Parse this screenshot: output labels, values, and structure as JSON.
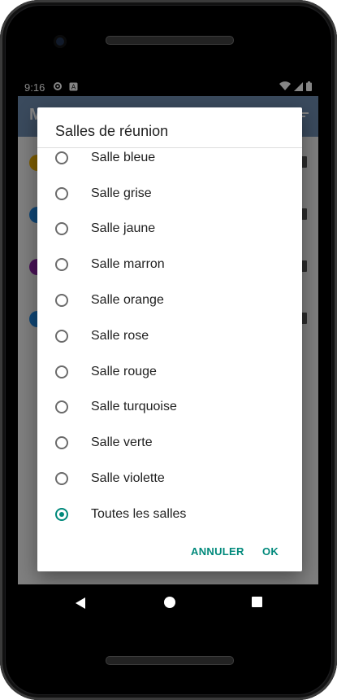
{
  "status_bar": {
    "time": "9:16",
    "icons": [
      "settings-icon",
      "a-icon",
      "wifi-icon",
      "signal-icon",
      "battery-icon"
    ]
  },
  "app_bar": {
    "title_visible": "M",
    "menu_icon": "sort-icon"
  },
  "background_rows": [
    {
      "dot_color": "#f4b400"
    },
    {
      "dot_color": "#1e88e5"
    },
    {
      "dot_color": "#8e24aa"
    },
    {
      "dot_color": "#1e88e5"
    }
  ],
  "dialog": {
    "title": "Salles de réunion",
    "options": [
      {
        "label": "Salle bleue",
        "checked": false
      },
      {
        "label": "Salle grise",
        "checked": false
      },
      {
        "label": "Salle jaune",
        "checked": false
      },
      {
        "label": "Salle marron",
        "checked": false
      },
      {
        "label": "Salle orange",
        "checked": false
      },
      {
        "label": "Salle rose",
        "checked": false
      },
      {
        "label": "Salle rouge",
        "checked": false
      },
      {
        "label": "Salle turquoise",
        "checked": false
      },
      {
        "label": "Salle verte",
        "checked": false
      },
      {
        "label": "Salle violette",
        "checked": false
      },
      {
        "label": "Toutes les salles",
        "checked": true
      }
    ],
    "cancel_label": "ANNULER",
    "ok_label": "OK"
  },
  "colors": {
    "accent": "#00897b",
    "fab": "#e53935",
    "app_bar": "#6f8fb3"
  }
}
